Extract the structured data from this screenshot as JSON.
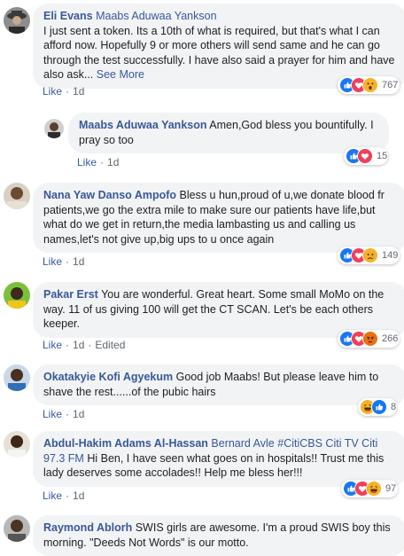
{
  "comments": [
    {
      "author": "Eli Evans",
      "mention": "Maabs Aduwaa Yankson",
      "text": "I just sent a token. Its a 10th of what is required, but that's what I can afford now. Hopefully 9 or more others will send same and he can go through the test successfully. I have also said a prayer for him and have also ask...",
      "see_more": "See More",
      "like": "Like",
      "time": "1d",
      "reaction_count": "767",
      "reactions": [
        "like-icon",
        "love-icon",
        "wow-icon"
      ]
    },
    {
      "author": "Maabs Aduwaa Yankson",
      "text": "Amen,God bless you bountifully. I pray so too",
      "like": "Like",
      "time": "1d",
      "reaction_count": "15",
      "reactions": [
        "like-icon",
        "love-icon"
      ]
    },
    {
      "author": "Nana Yaw Danso Ampofo",
      "text": "Bless u hun,proud of u,we donate blood fr patients,we go the extra mile to make sure our patients have life,but what do we get in return,the media lambasting us and calling us names,let's not give up,big ups to u once again",
      "like": "Like",
      "time": "1d",
      "reaction_count": "149",
      "reactions": [
        "like-icon",
        "love-icon",
        "sad-icon"
      ]
    },
    {
      "author": "Pakar Erst",
      "text": "You are wonderful. Great heart. Some small MoMo on the way. 11 of us giving 100 will get the CT SCAN. Let's be each others keeper.",
      "like": "Like",
      "time": "1d",
      "edited": "Edited",
      "reaction_count": "266",
      "reactions": [
        "like-icon",
        "love-icon",
        "angry-icon"
      ]
    },
    {
      "author": "Okatakyie Kofi Agyekum",
      "text": "Good job Maabs! But please leave him to shave the rest......of the pubic hairs",
      "like": "Like",
      "time": "1d",
      "reaction_count": "8",
      "reactions": [
        "haha-icon",
        "like-icon"
      ]
    },
    {
      "author": "Abdul-Hakim Adams Al-Hassan",
      "mention": "Bernard Avle",
      "text_tail": "#CitiCBS Citi TV Citi 97.3 FM",
      "text": "Hi Ben, I have seen what goes on in hospitals!! Trust me this lady deserves some accolades!! Help me bless her!!!",
      "like": "Like",
      "time": "1d",
      "reaction_count": "97",
      "reactions": [
        "like-icon",
        "love-icon",
        "haha-icon"
      ]
    },
    {
      "author": "Raymond Ablorh",
      "text": "SWIS girls are awesome. I'm a proud SWIS boy this morning. \"Deeds Not Words\" is our motto."
    }
  ],
  "colors": {
    "link": "#385898",
    "bubble": "#f2f3f5",
    "meta": "#606770",
    "like_blue": "#1877f2",
    "love_red": "#f33e58",
    "emoji_yellow": "#f7b125"
  }
}
